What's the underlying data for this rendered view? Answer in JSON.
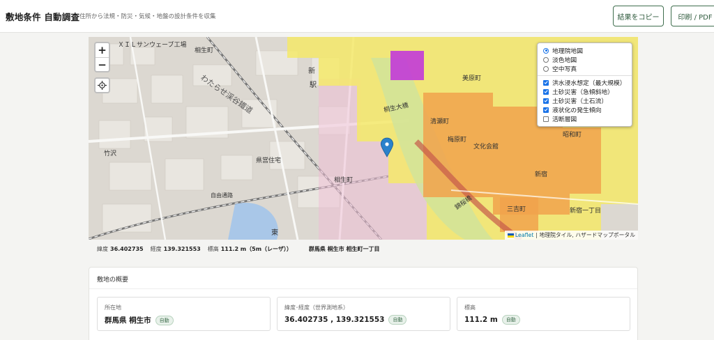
{
  "header": {
    "title": "敷地条件 自動調査",
    "subtitle": "住所から法規・防災・気候・地盤の設計条件を収集",
    "copy_button": "結果をコピー",
    "print_button": "印刷 / PDF"
  },
  "map": {
    "zoom_in": "+",
    "zoom_out": "−",
    "base_layers": [
      {
        "label": "地理院地図",
        "selected": true
      },
      {
        "label": "淡色地図",
        "selected": false
      },
      {
        "label": "空中写真",
        "selected": false
      }
    ],
    "overlays": [
      {
        "label": "洪水浸水想定（最大規模）",
        "checked": true
      },
      {
        "label": "土砂災害（急傾斜地）",
        "checked": true
      },
      {
        "label": "土砂災害（土石流）",
        "checked": true
      },
      {
        "label": "液状化の発生傾向",
        "checked": true
      },
      {
        "label": "活断層図",
        "checked": false
      }
    ],
    "attribution_leaflet": "Leaflet",
    "attribution_rest": "| 地理院タイル, ハザードマップポータル",
    "labels": {
      "l1": "ＸＩＬサンウェーブ工場",
      "l2": "相生町",
      "l3": "わたらせ渓谷鐵道",
      "l4": "新",
      "l5": "駅",
      "l6": "相生町",
      "l7": "桐生大橋",
      "l8": "美原町",
      "l9": "清瀬町",
      "l10": "梅原町",
      "l11": "文化会館",
      "l12": "新宿",
      "l13": "三吉町",
      "l14": "昭和町",
      "l15": "新宿一丁目",
      "l16": "錦桜橋",
      "l17": "竹沢",
      "l18": "県営住宅",
      "l19": "自由通路",
      "l20": "東"
    }
  },
  "location": {
    "lat_label": "緯度",
    "lat": "36.402735",
    "lng_label": "経度",
    "lng": "139.321553",
    "elev_label": "標高",
    "elev": "111.2 m（5m（レーザ））",
    "address": "群馬県 桐生市 相生町一丁目"
  },
  "summary": {
    "title": "敷地の概要",
    "cards": [
      {
        "label": "所在地",
        "value": "群馬県 桐生市",
        "badge": "自動"
      },
      {
        "label": "緯度･経度（世界測地系）",
        "value": "36.402735 , 139.321553",
        "badge": "自動"
      },
      {
        "label": "標高",
        "value": "111.2 m",
        "badge": "自動"
      }
    ]
  },
  "colors": {
    "accent": "#3f6e4e",
    "hazard_yellow": "#f5e96b",
    "hazard_orange": "#f5a94e",
    "hazard_purple": "#c03ad6",
    "pin": "#2a81cb"
  }
}
